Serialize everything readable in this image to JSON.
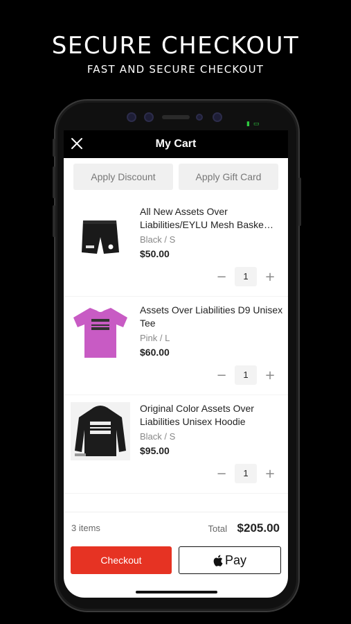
{
  "hero": {
    "title": "SECURE CHECKOUT",
    "subtitle": "FAST AND SECURE CHECKOUT"
  },
  "nav": {
    "title": "My Cart",
    "close_icon": "close-icon"
  },
  "discounts": {
    "apply_discount": "Apply Discount",
    "apply_gift_card": "Apply Gift Card"
  },
  "items": [
    {
      "name": "All New Assets Over Liabilities/EYLU Mesh Baske…",
      "variant": "Black / S",
      "price": "$50.00",
      "quantity": "1",
      "image": "black-shorts"
    },
    {
      "name": "Assets Over Liabilities D9 Unisex Tee",
      "variant": "Pink / L",
      "price": "$60.00",
      "quantity": "1",
      "image": "pink-tee"
    },
    {
      "name": "Original Color Assets Over Liabilities Unisex Hoodie",
      "variant": "Black / S",
      "price": "$95.00",
      "quantity": "1",
      "image": "black-hoodie"
    }
  ],
  "qty_controls": {
    "minus": "−",
    "plus": "+"
  },
  "summary": {
    "item_count": "3 items",
    "total_label": "Total",
    "total_value": "$205.00"
  },
  "actions": {
    "checkout": "Checkout",
    "apple_pay": "Pay"
  },
  "colors": {
    "checkout": "#e63323",
    "background": "#000000"
  }
}
